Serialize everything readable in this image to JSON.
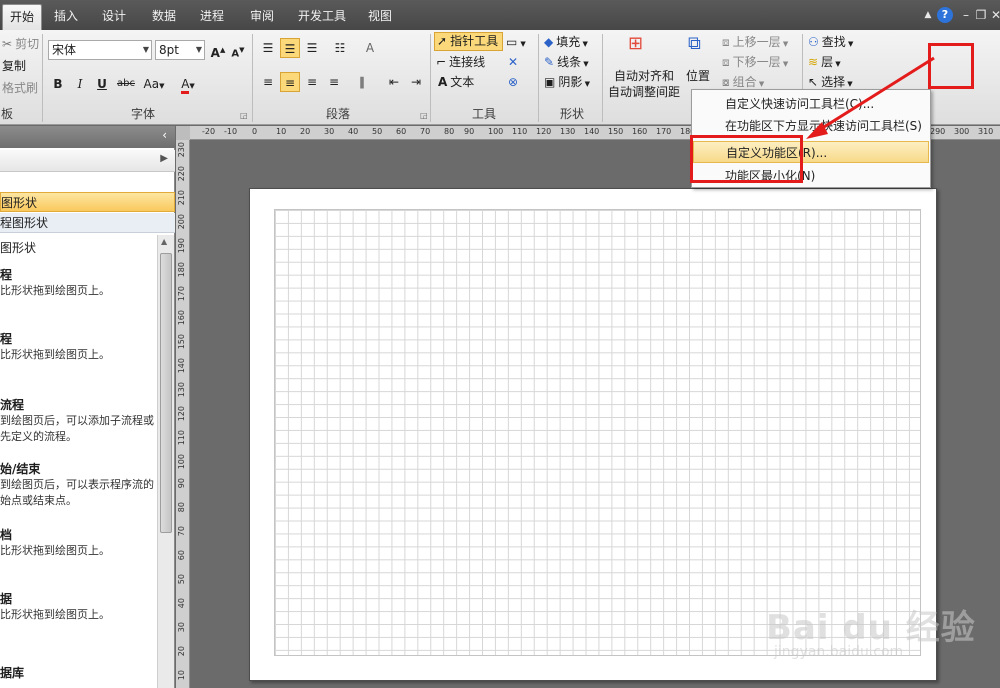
{
  "tabs": [
    "开始",
    "插入",
    "设计",
    "数据",
    "进程",
    "审阅",
    "开发工具",
    "视图"
  ],
  "window_controls": {
    "minimize_ribbon": "▲",
    "help": "?",
    "minimize": "–",
    "restore": "❐",
    "close": "✕"
  },
  "clipboard": {
    "cut": "剪切",
    "copy": "复制",
    "format_painter": "格式刷",
    "label": "板"
  },
  "font": {
    "family": "宋体",
    "size": "8pt",
    "grow": "A",
    "shrink": "A",
    "bold": "B",
    "italic": "I",
    "underline": "U",
    "strike": "abc",
    "case": "Aa",
    "color": "A",
    "label": "字体"
  },
  "paragraph": {
    "label": "段落"
  },
  "tools": {
    "pointer": "指针工具",
    "connector": "连接线",
    "text": "文本",
    "label": "工具"
  },
  "shape": {
    "fill": "填充",
    "line": "线条",
    "shadow": "阴影",
    "label": "形状"
  },
  "arrange": {
    "auto_align": "自动对齐和",
    "auto_space": "自动调整间距",
    "position": "位置",
    "bring_forward": "上移一层",
    "send_backward": "下移一层",
    "group": "组合"
  },
  "editing": {
    "find": "查找",
    "layer": "层",
    "select": "选择"
  },
  "shapes_pane": {
    "more_shapes": "",
    "stencil_active": "图形状",
    "stencil_other": "程图形状",
    "stencil_title": "图形状",
    "items": [
      {
        "name": "程",
        "desc": "比形状拖到绘图页上。"
      },
      {
        "name": "程",
        "desc": "比形状拖到绘图页上。"
      },
      {
        "name": "流程",
        "desc": "到绘图页后，可以添加子流程或\n先定义的流程。"
      },
      {
        "name": "始/结束",
        "desc": "到绘图页后，可以表示程序流的\n始点或结束点。"
      },
      {
        "name": "档",
        "desc": "比形状拖到绘图页上。"
      },
      {
        "name": "据",
        "desc": "比形状拖到绘图页上。"
      },
      {
        "name": "据库",
        "desc": ""
      }
    ]
  },
  "hruler_ticks": [
    "-20",
    "-10",
    "0",
    "10",
    "20",
    "30",
    "40",
    "50",
    "60",
    "70",
    "80",
    "90",
    "100",
    "110",
    "120",
    "130",
    "140",
    "150",
    "160",
    "170",
    "180",
    "290",
    "300",
    "310"
  ],
  "vruler_ticks": [
    "230",
    "220",
    "210",
    "200",
    "190",
    "180",
    "170",
    "160",
    "150",
    "140",
    "130",
    "120",
    "110",
    "100",
    "90",
    "80",
    "70",
    "60",
    "50",
    "40",
    "30",
    "20",
    "10",
    "0"
  ],
  "context_menu": [
    "自定义快速访问工具栏(C)...",
    "在功能区下方显示快速访问工具栏(S)",
    "自定义功能区(R)...",
    "功能区最小化(N)"
  ],
  "watermark": {
    "brand": "Bai du 经验",
    "url": "jingyan.baidu.com"
  },
  "colors": {
    "accent_red": "#e41b1b",
    "highlight": "#f9c95d"
  }
}
